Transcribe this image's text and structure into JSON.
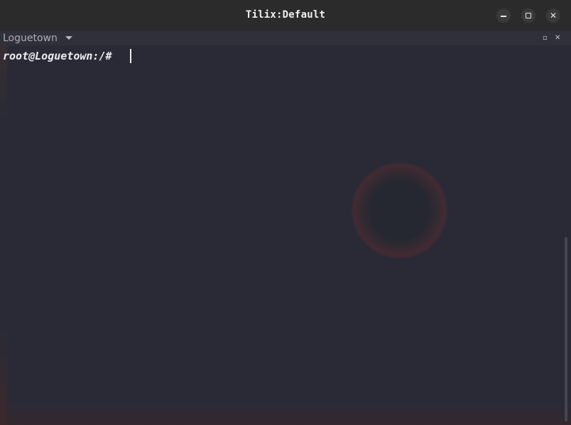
{
  "window": {
    "title": "Tilix:Default"
  },
  "titlebar": {
    "minimize_icon": "minimize-icon",
    "maximize_icon": "maximize-icon",
    "close_icon": "close-icon",
    "close_glyph": "✕"
  },
  "session": {
    "title": "Loguetown",
    "dropdown_icon": "chevron-down-icon",
    "restore_icon": "restore-icon",
    "close_icon": "close-icon",
    "restore_glyph": "▫",
    "close_glyph": "✕"
  },
  "terminal": {
    "prompt": "root@Loguetown:/# "
  },
  "colors": {
    "titlebar": "#2b2b2b",
    "terminal_bg": "#2a2a36",
    "text": "#eceef2"
  }
}
